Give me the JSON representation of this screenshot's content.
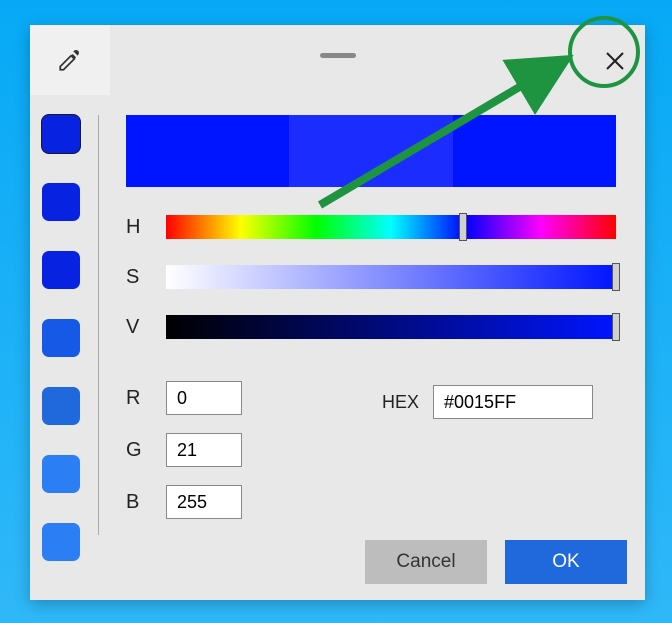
{
  "hsv_labels": {
    "h": "H",
    "s": "S",
    "v": "V"
  },
  "rgb_labels": {
    "r": "R",
    "g": "G",
    "b": "B"
  },
  "rgb": {
    "r": "0",
    "g": "21",
    "b": "255"
  },
  "hex": {
    "label": "HEX",
    "value": "#0015FF"
  },
  "buttons": {
    "cancel": "Cancel",
    "ok": "OK"
  },
  "swatches": [
    {
      "color": "#0722E0",
      "selected": true
    },
    {
      "color": "#0722E0",
      "selected": false
    },
    {
      "color": "#0722E0",
      "selected": false
    },
    {
      "color": "#1559E6",
      "selected": false
    },
    {
      "color": "#1F69DD",
      "selected": false
    },
    {
      "color": "#2B7EF3",
      "selected": false
    },
    {
      "color": "#2B7EF3",
      "selected": false
    }
  ],
  "hsv": {
    "h_pct": 65,
    "s_pct": 99,
    "v_pct": 99
  },
  "preview": {
    "left": "#0015FF",
    "mid": "#1A2CFF",
    "right": "#0015FF"
  },
  "icons": {
    "eyedropper": "eyedropper-icon",
    "close": "close-icon"
  }
}
